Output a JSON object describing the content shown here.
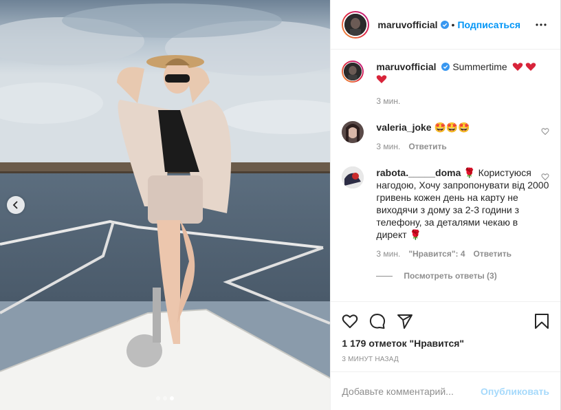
{
  "post": {
    "author": "maruvofficial",
    "follow_label": "Подписаться",
    "separator": "•",
    "caption_text": "Summertime",
    "caption_time": "3 мин."
  },
  "comments": [
    {
      "username": "valeria_joke",
      "text": "🤩🤩🤩",
      "time": "3 мин.",
      "reply_label": "Ответить"
    },
    {
      "username": "rabota._____doma",
      "text": "🌹 Користуюся нагодою, Хочу запропонувати від 2000 гривень кожен день на карту не виходячи з дому за 2-3 години з телефону, за деталями чекаю в директ 🌹",
      "time": "3 мин.",
      "likes_label": "\"Нравится\": 4",
      "reply_label": "Ответить",
      "view_replies_label": "Посмотреть ответы (3)"
    }
  ],
  "actions": {
    "likes_count": "1 179 отметок \"Нравится\"",
    "timestamp": "3 минут назад"
  },
  "add_comment": {
    "placeholder": "Добавьте комментарий...",
    "post_label": "Опубликовать"
  },
  "colors": {
    "accent": "#0095f6",
    "verified": "#3897f0",
    "heart": "#ed4956"
  },
  "carousel": {
    "total": 3,
    "active_index": 2
  },
  "icons": [
    "chevron-left-icon",
    "verified-badge-icon",
    "more-options-icon",
    "heart-icon",
    "comment-icon",
    "share-icon",
    "bookmark-icon"
  ]
}
